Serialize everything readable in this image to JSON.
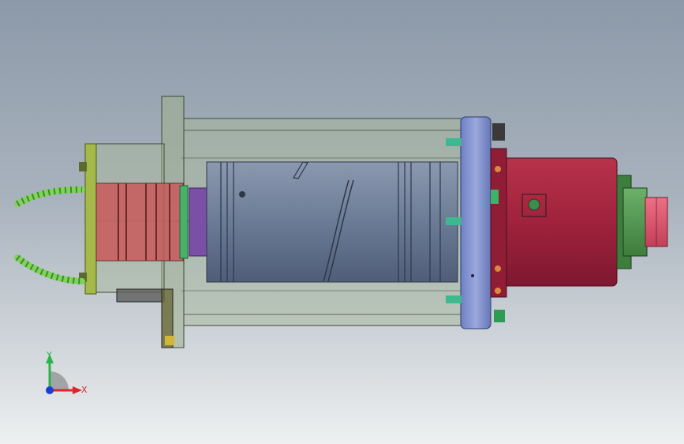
{
  "viewport": {
    "background_top": "#8c99a8",
    "background_bottom": "#eef0f1"
  },
  "triad": {
    "x_label": "X",
    "y_label": "Y",
    "x_color": "#e0252a",
    "y_color": "#2bb34a",
    "z_color": "#1a3fd6"
  },
  "model": {
    "flange_color": "#7b8fd0",
    "front_cap_color": "#9e1f3a",
    "nose_color": "#4f9a4f",
    "tip_color": "#d9536a",
    "rotor_color": "#6f7f99",
    "housing_color": "#a8b89a",
    "rear_ring_color": "#c85a5a",
    "mount_plate_color": "#a5b84a",
    "hose_color": "#7fd35a",
    "icons": [
      "spindle-housing",
      "mounting-flange",
      "rotor-cylinder",
      "front-cap",
      "cooling-hoses",
      "coordinate-triad"
    ]
  }
}
